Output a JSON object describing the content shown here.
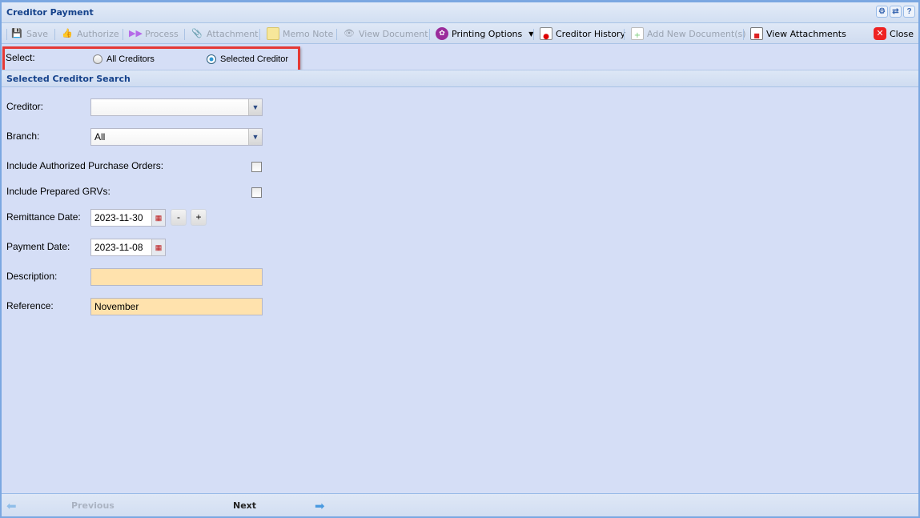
{
  "window": {
    "title": "Creditor Payment",
    "tools": [
      "gear",
      "refresh",
      "?"
    ]
  },
  "toolbar": {
    "save": "Save",
    "authorize": "Authorize",
    "process": "Process",
    "attachment": "Attachment",
    "memo_note": "Memo Note",
    "view_document": "View Document",
    "printing_options": "Printing Options",
    "creditor_history": "Creditor History",
    "add_new_documents": "Add New Document(s)",
    "view_attachments": "View Attachments",
    "close": "Close"
  },
  "select": {
    "label": "Select:",
    "options": [
      "All Creditors",
      "Selected Creditor"
    ],
    "selected": "Selected Creditor"
  },
  "section": {
    "title": "Selected Creditor Search"
  },
  "form": {
    "creditor_label": "Creditor:",
    "creditor_value": "",
    "branch_label": "Branch:",
    "branch_value": "All",
    "include_po_label": "Include Authorized Purchase Orders:",
    "include_po_checked": false,
    "include_grv_label": "Include Prepared GRVs:",
    "include_grv_checked": false,
    "remittance_label": "Remittance Date:",
    "remittance_value": "2023-11-30",
    "minus": "-",
    "plus": "+",
    "payment_label": "Payment Date:",
    "payment_value": "2023-11-08",
    "description_label": "Description:",
    "description_value": "",
    "reference_label": "Reference:",
    "reference_value": "November"
  },
  "footer": {
    "previous": "Previous",
    "next": "Next"
  }
}
